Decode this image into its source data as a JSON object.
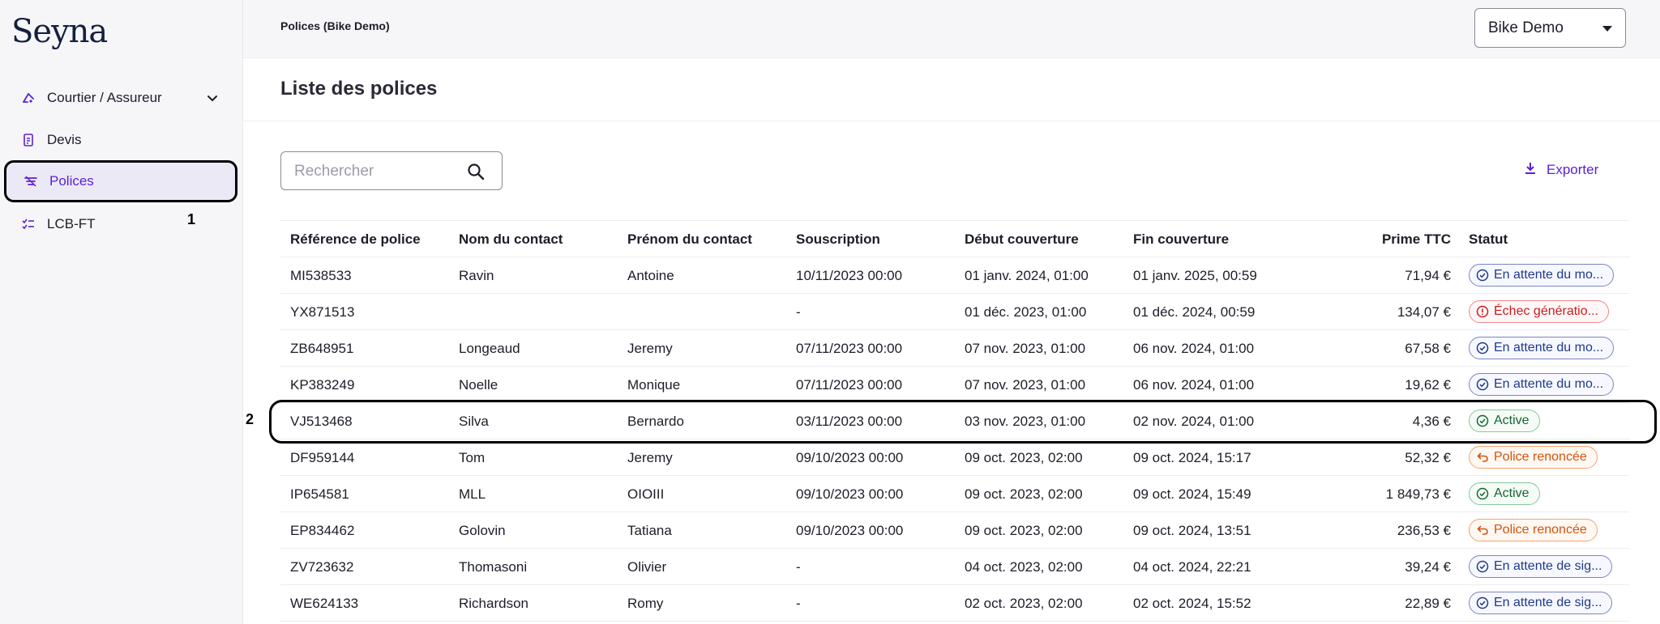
{
  "sidebar": {
    "logo": "Seyna",
    "items": [
      {
        "label": "Courtier / Assureur",
        "icon": "broker-icon"
      },
      {
        "label": "Devis",
        "icon": "quote-doc-icon"
      },
      {
        "label": "Polices",
        "icon": "policy-icon",
        "active": true
      },
      {
        "label": "LCB-FT",
        "icon": "checklist-icon"
      }
    ],
    "annotation_1": "1"
  },
  "topbar": {
    "breadcrumb": "Polices (Bike Demo)",
    "select_value": "Bike Demo"
  },
  "page": {
    "title": "Liste des polices"
  },
  "search": {
    "placeholder": "Rechercher"
  },
  "toolbar": {
    "export_label": "Exporter"
  },
  "table": {
    "headers": [
      "Référence de police",
      "Nom du contact",
      "Prénom du contact",
      "Souscription",
      "Début couverture",
      "Fin couverture",
      "Prime TTC",
      "Statut"
    ],
    "rows": [
      {
        "ref": "MI538533",
        "nom": "Ravin",
        "prenom": "Antoine",
        "souscription": "10/11/2023 00:00",
        "debut": "01 janv. 2024, 01:00",
        "fin": "01 janv. 2025, 00:59",
        "prime": "71,94 €",
        "statut": "En attente du mo...",
        "statut_type": "wait"
      },
      {
        "ref": "YX871513",
        "nom": "",
        "prenom": "",
        "souscription": "-",
        "debut": "01 déc. 2023, 01:00",
        "fin": "01 déc. 2024, 00:59",
        "prime": "134,07 €",
        "statut": "Échec génératio...",
        "statut_type": "error"
      },
      {
        "ref": "ZB648951",
        "nom": "Longeaud",
        "prenom": "Jeremy",
        "souscription": "07/11/2023 00:00",
        "debut": "07 nov. 2023, 01:00",
        "fin": "06 nov. 2024, 01:00",
        "prime": "67,58 €",
        "statut": "En attente du mo...",
        "statut_type": "wait"
      },
      {
        "ref": "KP383249",
        "nom": "Noelle",
        "prenom": "Monique",
        "souscription": "07/11/2023 00:00",
        "debut": "07 nov. 2023, 01:00",
        "fin": "06 nov. 2024, 01:00",
        "prime": "19,62 €",
        "statut": "En attente du mo...",
        "statut_type": "wait"
      },
      {
        "ref": "VJ513468",
        "nom": "Silva",
        "prenom": "Bernardo",
        "souscription": "03/11/2023 00:00",
        "debut": "03 nov. 2023, 01:00",
        "fin": "02 nov. 2024, 01:00",
        "prime": "4,36 €",
        "statut": "Active",
        "statut_type": "active"
      },
      {
        "ref": "DF959144",
        "nom": "Tom",
        "prenom": "Jeremy",
        "souscription": "09/10/2023 00:00",
        "debut": "09 oct. 2023, 02:00",
        "fin": "09 oct. 2024, 15:17",
        "prime": "52,32 €",
        "statut": "Police renoncée",
        "statut_type": "renounced"
      },
      {
        "ref": "IP654581",
        "nom": "MLL",
        "prenom": "OIOIII",
        "souscription": "09/10/2023 00:00",
        "debut": "09 oct. 2023, 02:00",
        "fin": "09 oct. 2024, 15:49",
        "prime": "1 849,73 €",
        "statut": "Active",
        "statut_type": "active"
      },
      {
        "ref": "EP834462",
        "nom": "Golovin",
        "prenom": "Tatiana",
        "souscription": "09/10/2023 00:00",
        "debut": "09 oct. 2023, 02:00",
        "fin": "09 oct. 2024, 13:51",
        "prime": "236,53 €",
        "statut": "Police renoncée",
        "statut_type": "renounced"
      },
      {
        "ref": "ZV723632",
        "nom": "Thomasoni",
        "prenom": "Olivier",
        "souscription": "-",
        "debut": "04 oct. 2023, 02:00",
        "fin": "04 oct. 2024, 22:21",
        "prime": "39,24 €",
        "statut": "En attente de sig...",
        "statut_type": "wait"
      },
      {
        "ref": "WE624133",
        "nom": "Richardson",
        "prenom": "Romy",
        "souscription": "-",
        "debut": "02 oct. 2023, 02:00",
        "fin": "02 oct. 2024, 15:52",
        "prime": "22,89 €",
        "statut": "En attente de sig...",
        "statut_type": "wait"
      }
    ],
    "annotation_2": "2"
  },
  "colors": {
    "accent": "#5b21d6",
    "wait": "#1e3a8a",
    "error": "#c81e1e",
    "active": "#166534",
    "renounced": "#d4520c"
  }
}
